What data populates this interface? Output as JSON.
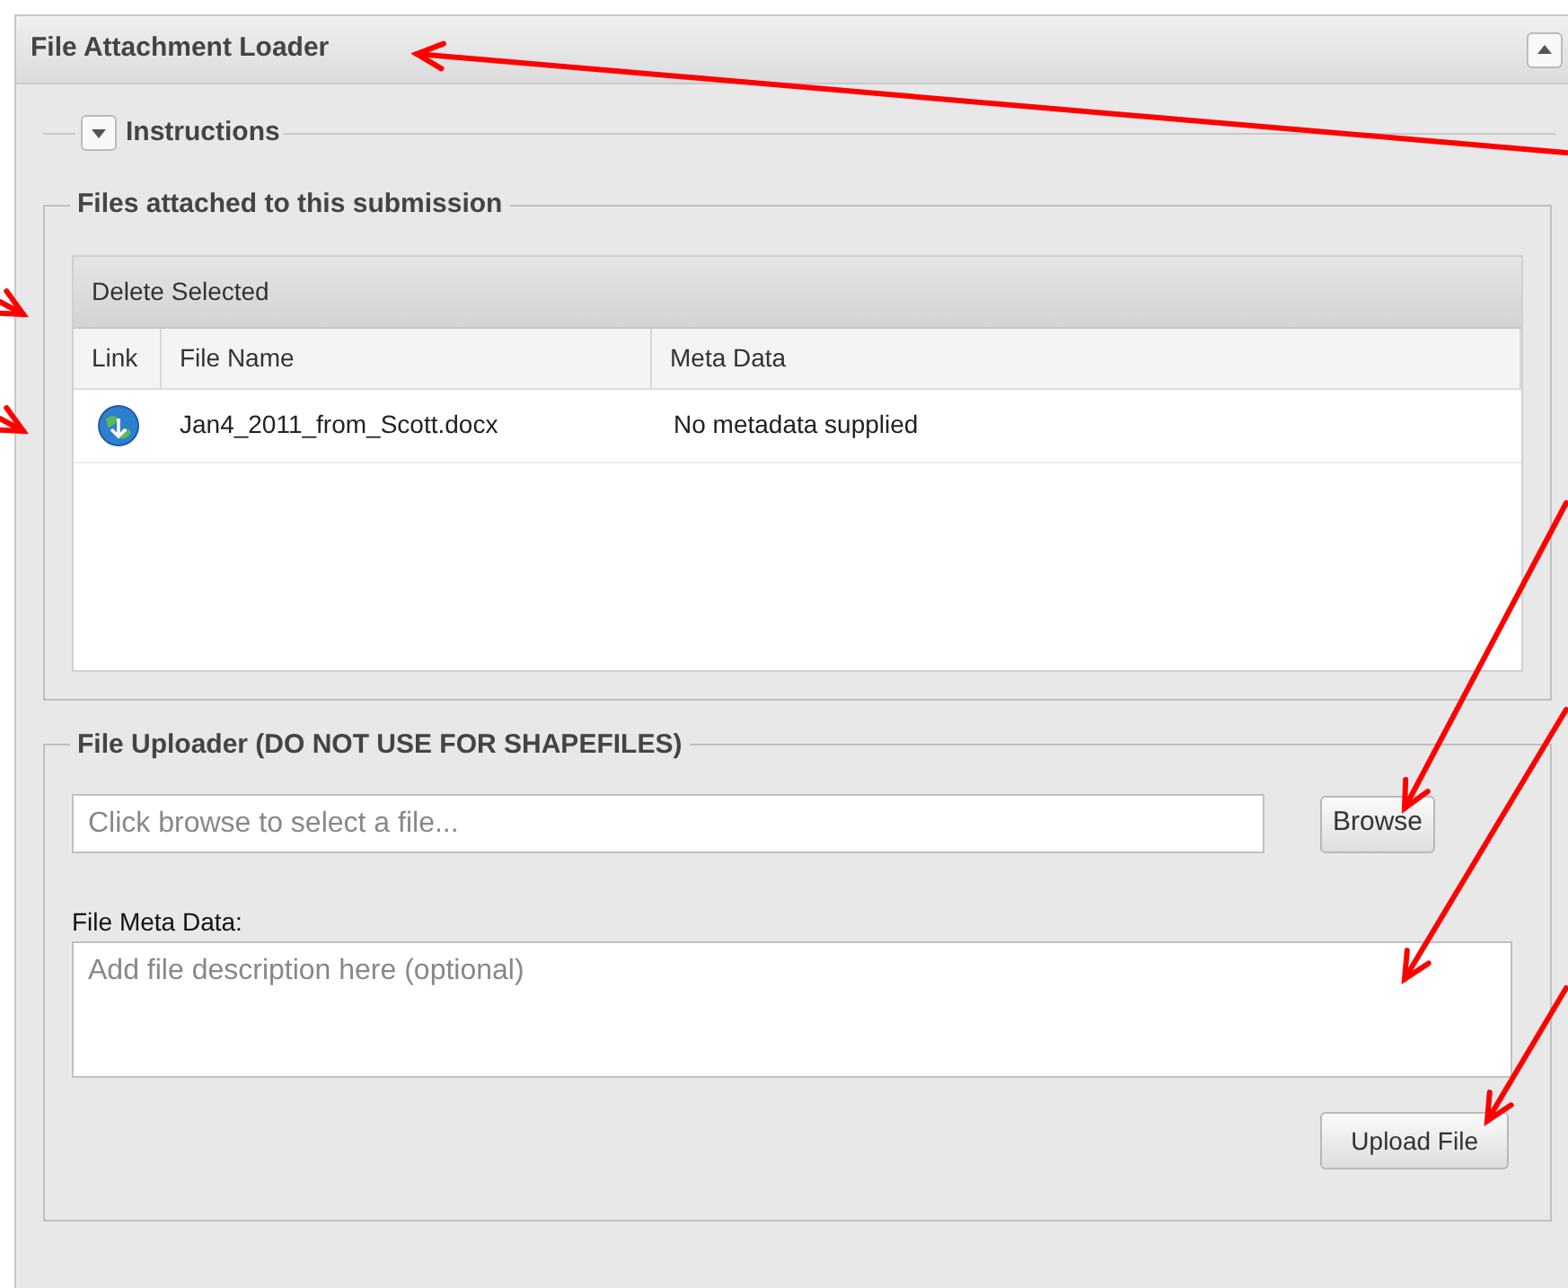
{
  "panel": {
    "title": "File Attachment Loader",
    "collapsed": false
  },
  "instructions": {
    "legend": "Instructions",
    "expanded": false
  },
  "attached": {
    "legend": "Files attached to this submission",
    "toolbar": {
      "button": "Delete Selected"
    },
    "columns": [
      "Link",
      "File Name",
      "Meta Data"
    ],
    "rows": [
      {
        "file_name": "Jan4_2011_from_Scott.docx",
        "meta": "No metadata supplied",
        "selected": false
      }
    ]
  },
  "uploader": {
    "legend": "File Uploader (DO NOT USE FOR SHAPEFILES)",
    "file_placeholder": "Click browse to select a file...",
    "browse_button": "Browse",
    "meta_label": "File Meta Data:",
    "meta_placeholder": "Add file description here (optional)",
    "upload_button": "Upload File"
  }
}
